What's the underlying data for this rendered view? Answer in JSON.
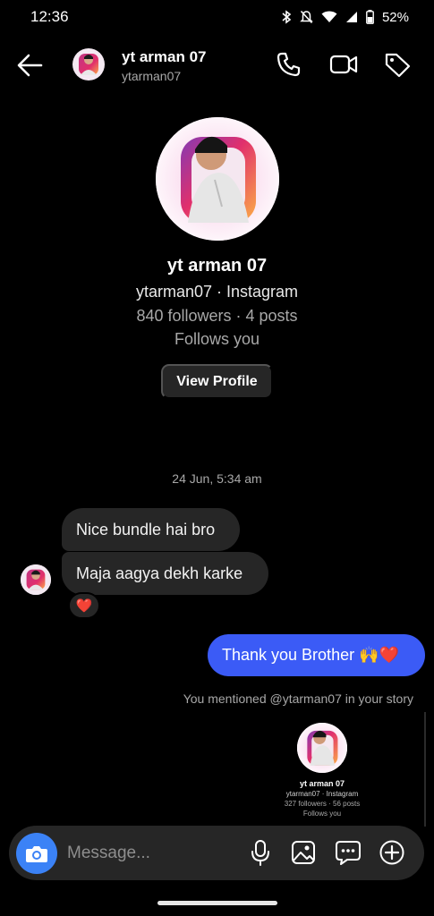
{
  "status_bar": {
    "time": "12:36",
    "battery": "52%",
    "icons": [
      "bluetooth-icon",
      "mute-icon",
      "wifi-icon",
      "signal-icon",
      "battery-icon"
    ]
  },
  "header": {
    "name": "yt arman 07",
    "username": "ytarman07",
    "icons": [
      "back-arrow-icon",
      "phone-icon",
      "video-icon",
      "tag-icon"
    ]
  },
  "profile": {
    "name": "yt arman 07",
    "source": "ytarman07 · Instagram",
    "stats": "840 followers · 4 posts",
    "follows": "Follows you",
    "button": "View Profile"
  },
  "chat": {
    "timestamp": "24 Jun, 5:34 am",
    "received": [
      {
        "text": "Nice bundle hai bro"
      },
      {
        "text": "Maja aagya dekh karke"
      }
    ],
    "reaction": "❤️",
    "sent": {
      "text": "Thank you Brother 🙌❤️"
    },
    "mention": "You mentioned @ytarman07 in your story"
  },
  "story_card": {
    "name": "yt arman 07",
    "source": "ytarman07 · Instagram",
    "stats": "327 followers · 56 posts",
    "follows": "Follows you"
  },
  "composer": {
    "placeholder": "Message...",
    "icons": [
      "camera-icon",
      "microphone-icon",
      "gallery-icon",
      "sticker-icon",
      "plus-icon"
    ]
  },
  "colors": {
    "background": "#000000",
    "bubble_received": "#262626",
    "bubble_sent": "#3b5bf6",
    "muted_text": "#a8a8a8",
    "camera_button": "#3b82f6"
  }
}
